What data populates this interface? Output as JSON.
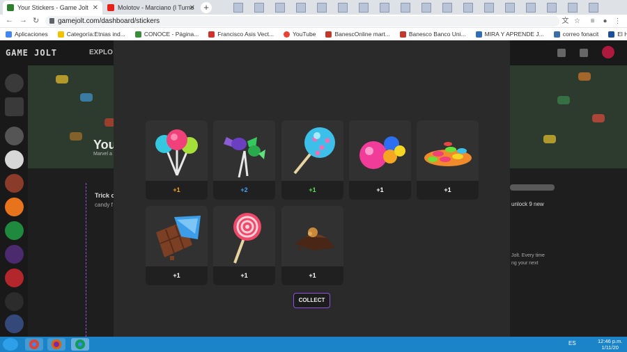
{
  "tabs": [
    {
      "title": "Your Stickers - Game Jolt",
      "active": true,
      "favicon": "gamejolt-icon"
    },
    {
      "title": "Molotov - Marciano (l Turne",
      "active": false,
      "favicon": "youtube-icon"
    }
  ],
  "address": {
    "url": "gamejolt.com/dashboard/stickers"
  },
  "bookmarks": [
    {
      "label": "Aplicaciones",
      "icon": "apps-grid-icon"
    },
    {
      "label": "Categoría:Etnias ind...",
      "icon": "flag-icon"
    },
    {
      "label": "CONOCE - Página...",
      "icon": "bookmark-icon"
    },
    {
      "label": "Francisco Asis Vect...",
      "icon": "pin-icon"
    },
    {
      "label": "YouTube",
      "icon": "google-icon"
    },
    {
      "label": "BanescOnline mart...",
      "icon": "banesco-icon"
    },
    {
      "label": "Banesco Banco Uni...",
      "icon": "banesco-icon"
    },
    {
      "label": "MIRA Y APRENDE J...",
      "icon": "mira-icon"
    },
    {
      "label": "correo fonacit",
      "icon": "mail-icon"
    },
    {
      "label": "El Hombre de la Ma...",
      "icon": "book-icon"
    }
  ],
  "site": {
    "logo": "GAME JOLT",
    "nav_explore": "EXPLO",
    "hero_title": "You",
    "hero_sub": "Marvel a",
    "trick_title": "Trick o",
    "trick_sub": "candy f",
    "right_text1": "unlock 9 new",
    "right_text2": "Jolt. Every time",
    "right_text3": "ng your next"
  },
  "stickers": [
    {
      "name": "lollipops",
      "count": "+1",
      "color": "#f5a623"
    },
    {
      "name": "wrapped-candies",
      "count": "+2",
      "color": "#4aa3f0"
    },
    {
      "name": "big-lollipop",
      "count": "+1",
      "color": "#5fe05f"
    },
    {
      "name": "gumballs",
      "count": "+1",
      "color": "#ffffff"
    },
    {
      "name": "candy-pile",
      "count": "+1",
      "color": "#ffffff"
    },
    {
      "name": "chocolate-bar",
      "count": "+1",
      "color": "#ffffff"
    },
    {
      "name": "swirl-lollipop",
      "count": "+1",
      "color": "#ffffff"
    },
    {
      "name": "chocolate-chunk",
      "count": "+1",
      "color": "#ffffff"
    }
  ],
  "collect_label": "COLLECT",
  "taskbar": {
    "lang": "ES",
    "time": "12:46 p.m.",
    "date": "1/11/20"
  }
}
